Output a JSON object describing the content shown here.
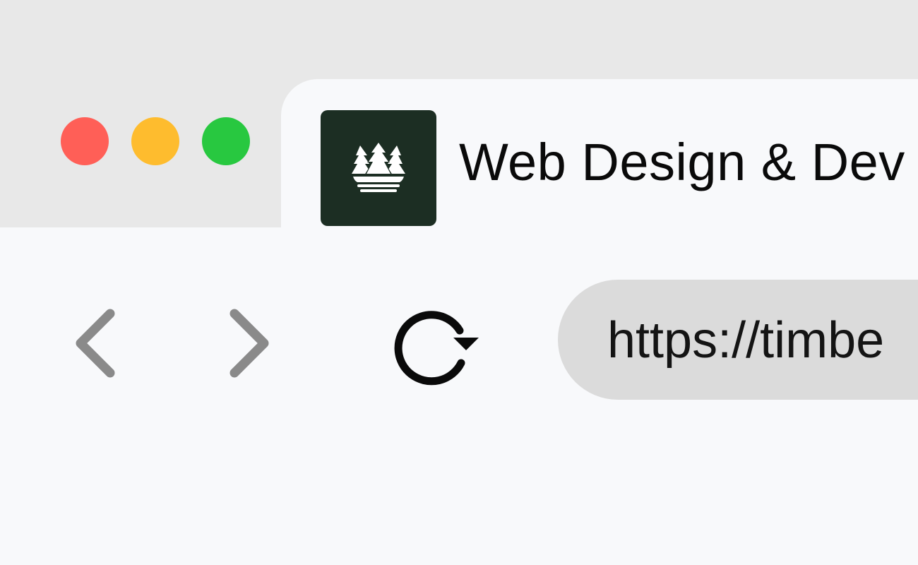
{
  "window": {
    "controls": [
      "close",
      "minimize",
      "zoom"
    ],
    "colors": {
      "close": "#ff5f57",
      "minimize": "#febc2e",
      "zoom": "#28c840",
      "titlebar": "#e8e8e8",
      "content": "#f8f9fb",
      "favicon_bg": "#1c2e23",
      "urlbar_bg": "#dbdbdb",
      "nav_icon": "#8a8a8a"
    }
  },
  "tab": {
    "title": "Web Design & Dev",
    "favicon": "pine-trees-icon"
  },
  "toolbar": {
    "back_icon": "chevron-left-icon",
    "forward_icon": "chevron-right-icon",
    "reload_icon": "reload-icon"
  },
  "address_bar": {
    "value": "https://timbe"
  }
}
